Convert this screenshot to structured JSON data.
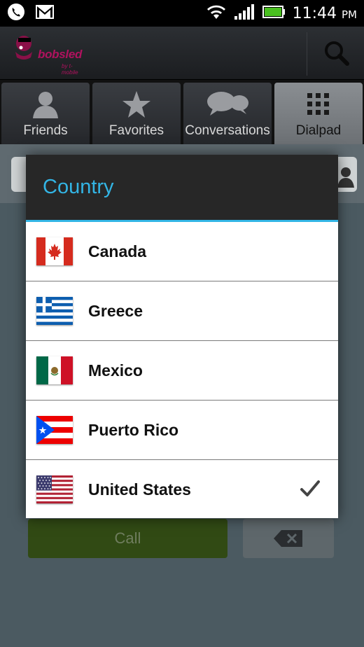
{
  "status_bar": {
    "time": "11:44",
    "ampm": "PM",
    "icons": [
      "phone-icon",
      "gmail-icon",
      "wifi-icon",
      "signal-icon",
      "battery-icon"
    ]
  },
  "app": {
    "logo_text": "bobsled",
    "logo_subtext": "by t-mobile",
    "search_icon": "search-icon"
  },
  "tabs": [
    {
      "label": "Friends",
      "icon": "person-icon",
      "active": false
    },
    {
      "label": "Favorites",
      "icon": "star-icon",
      "active": false
    },
    {
      "label": "Conversations",
      "icon": "chat-bubbles-icon",
      "active": false
    },
    {
      "label": "Dialpad",
      "icon": "dialpad-icon",
      "active": true
    }
  ],
  "main": {
    "call_label": "Call",
    "backspace_icon": "backspace-icon"
  },
  "dialog": {
    "title": "Country",
    "countries": [
      {
        "name": "Canada",
        "flag": "canada-flag",
        "selected": false
      },
      {
        "name": "Greece",
        "flag": "greece-flag",
        "selected": false
      },
      {
        "name": "Mexico",
        "flag": "mexico-flag",
        "selected": false
      },
      {
        "name": "Puerto Rico",
        "flag": "puerto-rico-flag",
        "selected": false
      },
      {
        "name": "United States",
        "flag": "us-flag",
        "selected": true
      }
    ]
  },
  "colors": {
    "accent": "#33b5e5",
    "brand": "#b0125e",
    "call_green": "#314a14"
  }
}
